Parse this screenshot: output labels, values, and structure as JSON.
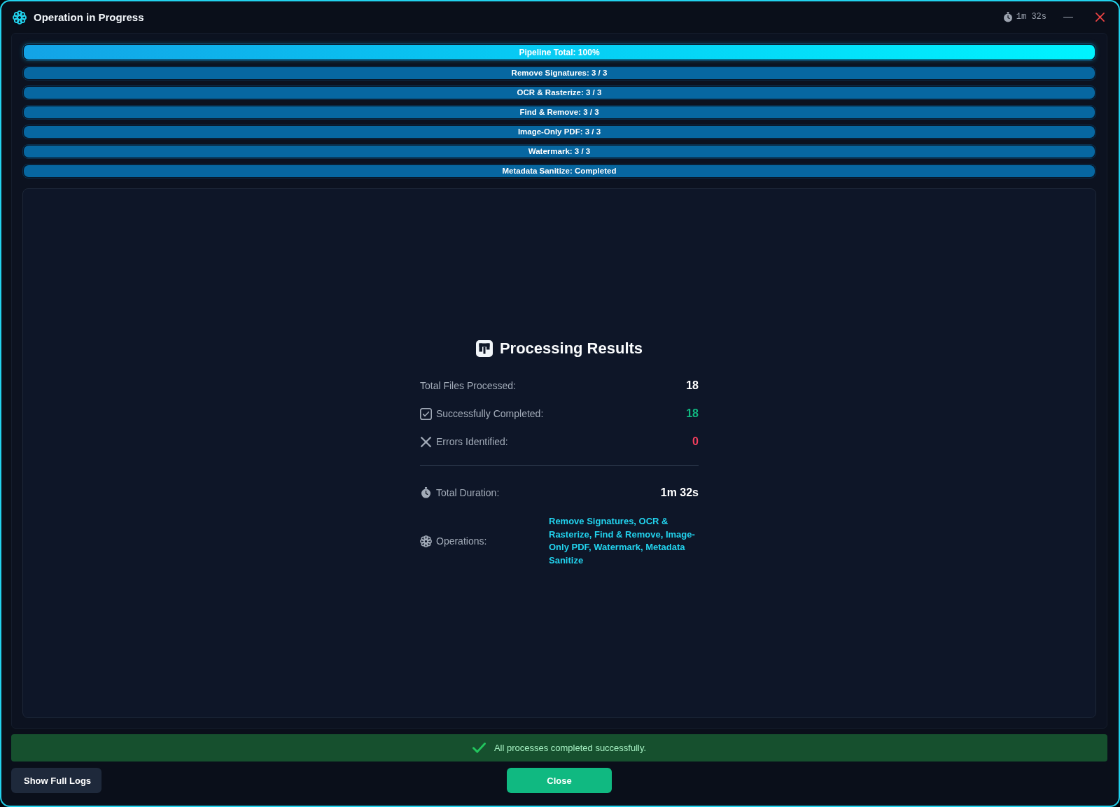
{
  "window": {
    "title": "Operation in Progress",
    "elapsed": "1m 32s"
  },
  "progress": [
    {
      "kind": "total",
      "label": "Pipeline Total: 100%",
      "level": 1
    },
    {
      "kind": "stage",
      "label": "Remove Signatures: 3 / 3",
      "level": 1
    },
    {
      "kind": "stage",
      "label": "OCR & Rasterize: 3 / 3",
      "level": 1
    },
    {
      "kind": "stage",
      "label": "Find & Remove: 3 / 3",
      "level": 1
    },
    {
      "kind": "stage",
      "label": "Image-Only PDF: 3 / 3",
      "level": 1
    },
    {
      "kind": "stage",
      "label": "Watermark: 3 / 3",
      "level": 1
    },
    {
      "kind": "stage",
      "label": "Metadata Sanitize: Completed",
      "level": 1
    }
  ],
  "results": {
    "title": "Processing Results",
    "stats": [
      {
        "kind": "plain",
        "label": "Total Files Processed:",
        "value": "18"
      },
      {
        "kind": "success",
        "label": "Successfully Completed:",
        "value": "18"
      },
      {
        "kind": "error",
        "label": "Errors Identified:",
        "value": "0"
      }
    ],
    "details": [
      {
        "kind": "duration",
        "label": "Total Duration:",
        "value": "1m 32s"
      },
      {
        "kind": "operations",
        "label": "Operations:",
        "value": "Remove Signatures, OCR & Rasterize, Find & Remove, Image-Only PDF, Watermark, Metadata Sanitize"
      }
    ]
  },
  "status": {
    "kind": "success",
    "message": "All processes completed successfully."
  },
  "buttons": [
    {
      "kind": "secondary",
      "label": "Show Full Logs"
    },
    {
      "kind": "primary",
      "label": "Close"
    }
  ]
}
